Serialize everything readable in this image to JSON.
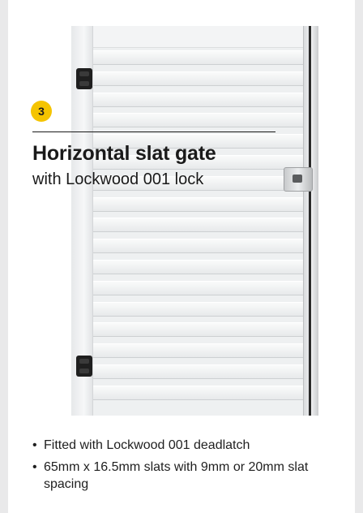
{
  "badge": "3",
  "title": "Horizontal slat gate",
  "subtitle": "with Lockwood 001 lock",
  "features": [
    "Fitted with Lockwood 001 deadlatch",
    "65mm x 16.5mm slats with 9mm or 20mm slat spacing"
  ],
  "colors": {
    "badge": "#f5c400",
    "background": "#e9e9ea",
    "card": "#ffffff"
  },
  "image": {
    "subject": "white horizontal slat gate with black hinges and lock"
  }
}
